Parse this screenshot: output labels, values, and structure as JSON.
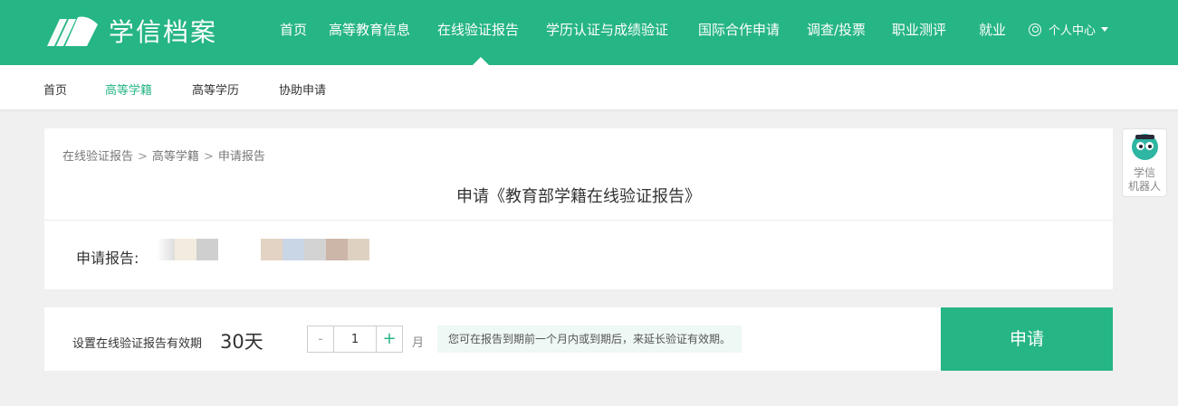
{
  "header": {
    "logo_text": "学信档案",
    "nav": [
      {
        "label": "首页"
      },
      {
        "label": "高等教育信息"
      },
      {
        "label": "在线验证报告"
      },
      {
        "label": "学历认证与成绩验证"
      },
      {
        "label": "国际合作申请"
      },
      {
        "label": "调查/投票"
      },
      {
        "label": "职业测评"
      },
      {
        "label": "就业"
      }
    ],
    "active_nav": "在线验证报告",
    "user_center": "个人中心"
  },
  "subnav": {
    "items": [
      {
        "label": "首页"
      },
      {
        "label": "高等学籍"
      },
      {
        "label": "高等学历"
      },
      {
        "label": "协助申请"
      }
    ],
    "active": "高等学籍"
  },
  "breadcrumb": {
    "items": [
      "在线验证报告",
      "高等学籍",
      "申请报告"
    ],
    "separator": ">"
  },
  "main": {
    "title": "申请《教育部学籍在线验证报告》",
    "report_label": "申请报告:"
  },
  "validity": {
    "label": "设置在线验证报告有效期",
    "value": "30天",
    "stepper_value": "1",
    "minus": "-",
    "plus": "+",
    "unit": "月",
    "tip": "您可在报告到期前一个月内或到期后，来延长验证有效期。",
    "apply_button": "申请"
  },
  "robot": {
    "label_line1": "学信",
    "label_line2": "机器人"
  },
  "colors": {
    "brand": "#26b584",
    "tip_bg": "#eef8f4"
  }
}
